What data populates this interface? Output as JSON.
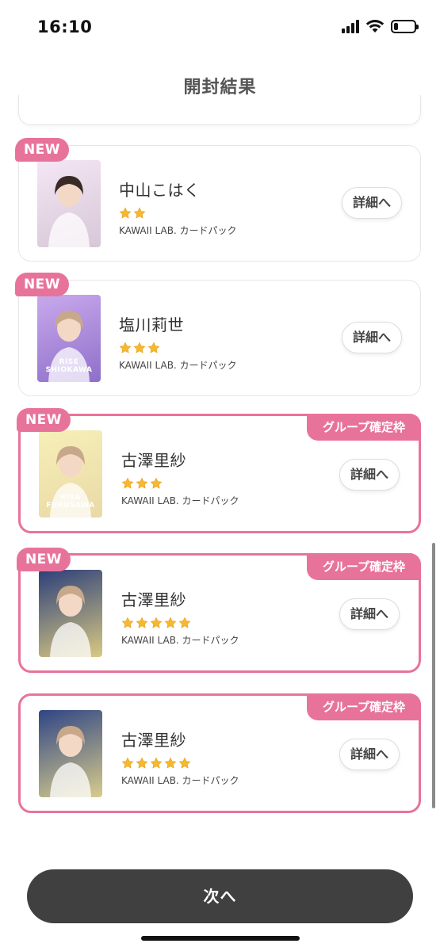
{
  "status_bar": {
    "time": "16:10",
    "battery_level": 0.22
  },
  "header": {
    "title": "開封結果"
  },
  "colors": {
    "accent": "#e8739a",
    "star": "#f5b82e",
    "next_button": "#404040"
  },
  "cards": [
    {
      "is_new": true,
      "group_slot": false,
      "name": "中山こはく",
      "stars": 2,
      "pack": "KAWAII LAB. カードパック",
      "detail_label": "詳細へ",
      "thumb_caption": "",
      "thumb_colors": [
        "#f4e6f4",
        "#d7c7d8"
      ]
    },
    {
      "is_new": true,
      "group_slot": false,
      "name": "塩川莉世",
      "stars": 3,
      "pack": "KAWAII LAB. カードパック",
      "detail_label": "詳細へ",
      "thumb_caption": "RISE SHIOKAWA",
      "thumb_colors": [
        "#c9a9ec",
        "#8e6fc9"
      ]
    },
    {
      "is_new": true,
      "group_slot": true,
      "name": "古澤里紗",
      "stars": 3,
      "pack": "KAWAII LAB. カードパック",
      "detail_label": "詳細へ",
      "thumb_caption": "RISA FURUSAWA",
      "thumb_colors": [
        "#f7efb7",
        "#e9d9a6"
      ]
    },
    {
      "is_new": true,
      "group_slot": true,
      "name": "古澤里紗",
      "stars": 5,
      "pack": "KAWAII LAB. カードパック",
      "detail_label": "詳細へ",
      "thumb_caption": "",
      "thumb_colors": [
        "#2c3f7a",
        "#d9c982"
      ]
    },
    {
      "is_new": false,
      "group_slot": true,
      "name": "古澤里紗",
      "stars": 5,
      "pack": "KAWAII LAB. カードパック",
      "detail_label": "詳細へ",
      "thumb_caption": "",
      "thumb_colors": [
        "#2f4585",
        "#d8cc8c"
      ]
    }
  ],
  "badges": {
    "new_label": "NEW",
    "group_label": "グループ確定枠"
  },
  "footer": {
    "next_label": "次へ"
  }
}
